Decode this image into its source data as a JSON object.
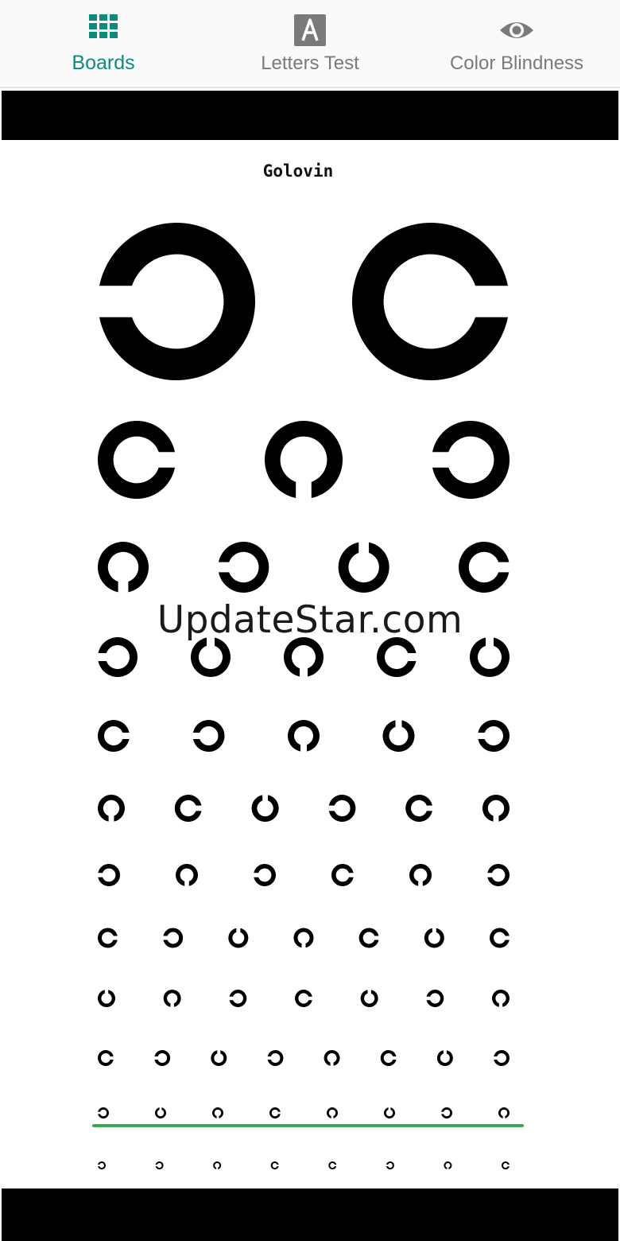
{
  "tabs": [
    {
      "label": "Boards",
      "icon": "grid-icon",
      "active": true
    },
    {
      "label": "Letters Test",
      "icon": "letter-a-icon",
      "active": false
    },
    {
      "label": "Color Blindness",
      "icon": "eye-icon",
      "active": false
    }
  ],
  "colors": {
    "accent": "#0f8a7a",
    "inactive": "#7a7a7a",
    "highlight_line": "#3aa655"
  },
  "chart": {
    "title": "Golovin",
    "rows": [
      {
        "gaps": [
          "left",
          "right"
        ]
      },
      {
        "gaps": [
          "right",
          "down",
          "left"
        ]
      },
      {
        "gaps": [
          "down",
          "left",
          "up",
          "right"
        ]
      },
      {
        "gaps": [
          "left",
          "up",
          "down",
          "right",
          "up"
        ]
      },
      {
        "gaps": [
          "right",
          "left",
          "down",
          "up",
          "left"
        ]
      },
      {
        "gaps": [
          "down",
          "right",
          "up",
          "left",
          "right",
          "down"
        ]
      },
      {
        "gaps": [
          "left",
          "down",
          "left",
          "right",
          "down",
          "left"
        ]
      },
      {
        "gaps": [
          "right",
          "left",
          "up",
          "down",
          "right",
          "up",
          "right"
        ]
      },
      {
        "gaps": [
          "up",
          "down",
          "left",
          "right",
          "up",
          "left",
          "down"
        ]
      },
      {
        "gaps": [
          "right",
          "left",
          "up",
          "left",
          "down",
          "right",
          "up",
          "left"
        ]
      },
      {
        "gaps": [
          "left",
          "up",
          "down",
          "right",
          "down",
          "up",
          "left",
          "down"
        ]
      },
      {
        "gaps": [
          "left",
          "left",
          "down",
          "right",
          "right",
          "left",
          "down",
          "right"
        ]
      }
    ],
    "highlighted_row": 10
  },
  "watermark": "UpdateStar.com"
}
